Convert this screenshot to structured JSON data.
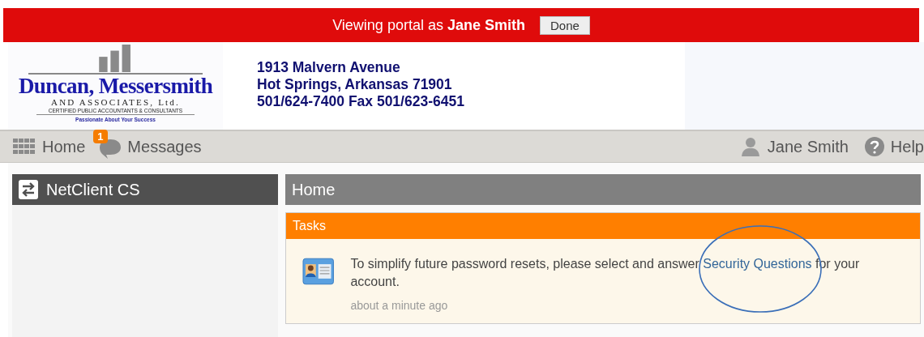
{
  "impersonation_bar": {
    "text": "Viewing portal as ",
    "user": "Jane Smith",
    "button": "Done"
  },
  "header": {
    "logo": {
      "name": "Duncan, Messersmith",
      "subtitle": "AND ASSOCIATES, Ltd.",
      "tagline": "CERTIFIED PUBLIC ACCOUNTANTS & CONSULTANTS",
      "motto": "Passionate About Your Success"
    },
    "address": [
      "1913 Malvern Avenue",
      "Hot Springs, Arkansas 71901",
      "501/624-7400 Fax 501/623-6451"
    ]
  },
  "nav": {
    "home": "Home",
    "messages": {
      "label": "Messages",
      "badge": "1"
    },
    "user": "Jane Smith",
    "help": "Help"
  },
  "sidebar": {
    "title": "NetClient CS"
  },
  "main": {
    "title": "Home",
    "tasks": {
      "title": "Tasks",
      "items": [
        {
          "before": "To simplify future password resets, please select and answer ",
          "link": "Security Questions",
          "after": " for your account.",
          "time": "about a minute ago",
          "circled": true
        }
      ]
    }
  }
}
